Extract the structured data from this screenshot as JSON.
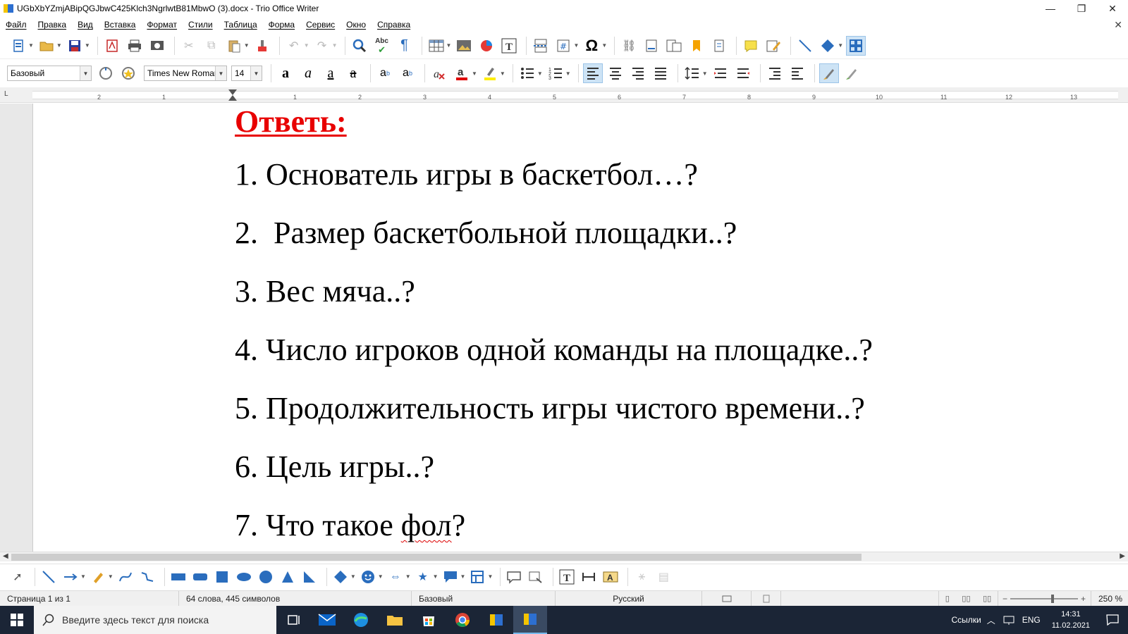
{
  "window": {
    "title": "UGbXbYZmjABipQGJbwC425Klch3NgrlwtB81MbwO (3).docx - Trio Office Writer",
    "minimize_glyph": "—",
    "restore_glyph": "❐",
    "close_glyph": "✕",
    "doc_close_glyph": "✕"
  },
  "menu": {
    "items": [
      "Файл",
      "Правка",
      "Вид",
      "Вставка",
      "Формат",
      "Стили",
      "Таблица",
      "Форма",
      "Сервис",
      "Окно",
      "Справка"
    ]
  },
  "toolbar1": {
    "icons": [
      "new-document-icon",
      "open-folder-icon",
      "save-icon",
      "export-pdf-icon",
      "print-icon",
      "print-preview-icon",
      "cut-icon",
      "copy-icon",
      "paste-icon",
      "clone-format-icon",
      "undo-icon",
      "redo-icon",
      "find-replace-icon",
      "spellcheck-icon",
      "formatting-marks-icon",
      "insert-table-icon",
      "insert-image-icon",
      "insert-chart-icon",
      "insert-textbox-icon",
      "page-break-icon",
      "insert-field-icon",
      "special-character-icon",
      "hyperlink-icon",
      "footnote-icon",
      "endnote-icon",
      "bookmark-icon",
      "cross-reference-icon",
      "comment-icon",
      "track-changes-icon",
      "line-icon",
      "basic-shapes-icon",
      "draw-functions-icon"
    ],
    "spellcheck_text": "Abc",
    "omega_glyph": "Ω"
  },
  "toolbar2": {
    "paragraph_style": "Базовый",
    "font_name": "Times New Roman",
    "font_size": "14"
  },
  "ruler": {
    "numbers": [
      "2",
      "1",
      "1",
      "2",
      "3",
      "4",
      "5",
      "6",
      "7",
      "8",
      "9",
      "10",
      "11",
      "12",
      "13"
    ],
    "tab_marker": "L"
  },
  "document": {
    "heading": "Ответь:",
    "items": [
      "1. Основатель игры в баскетбол…?",
      "2.  Размер баскетбольной площадки..?",
      "3. Вес мяча..?",
      "4. Число игроков одной команды на площадке..?",
      "5. Продолжительность игры чистого времени..?",
      "6. Цель игры..?"
    ],
    "item7_prefix": "7. Что такое ",
    "item7_misspelled": "фол",
    "item7_suffix": "?",
    "colors": {
      "heading": "#e80000",
      "text": "#000000",
      "spelling_underline": "#dd0000"
    }
  },
  "statusbar": {
    "page": "Страница 1 из 1",
    "words": "64 слова, 445 символов",
    "style": "Базовый",
    "language": "Русский",
    "zoom": "250 %",
    "zoom_minus": "−",
    "zoom_plus": "+"
  },
  "taskbar": {
    "search_placeholder": "Введите здесь текст для поиска",
    "links_label": "Ссылки",
    "lang": "ENG",
    "time": "14:31",
    "date": "11.02.2021"
  }
}
